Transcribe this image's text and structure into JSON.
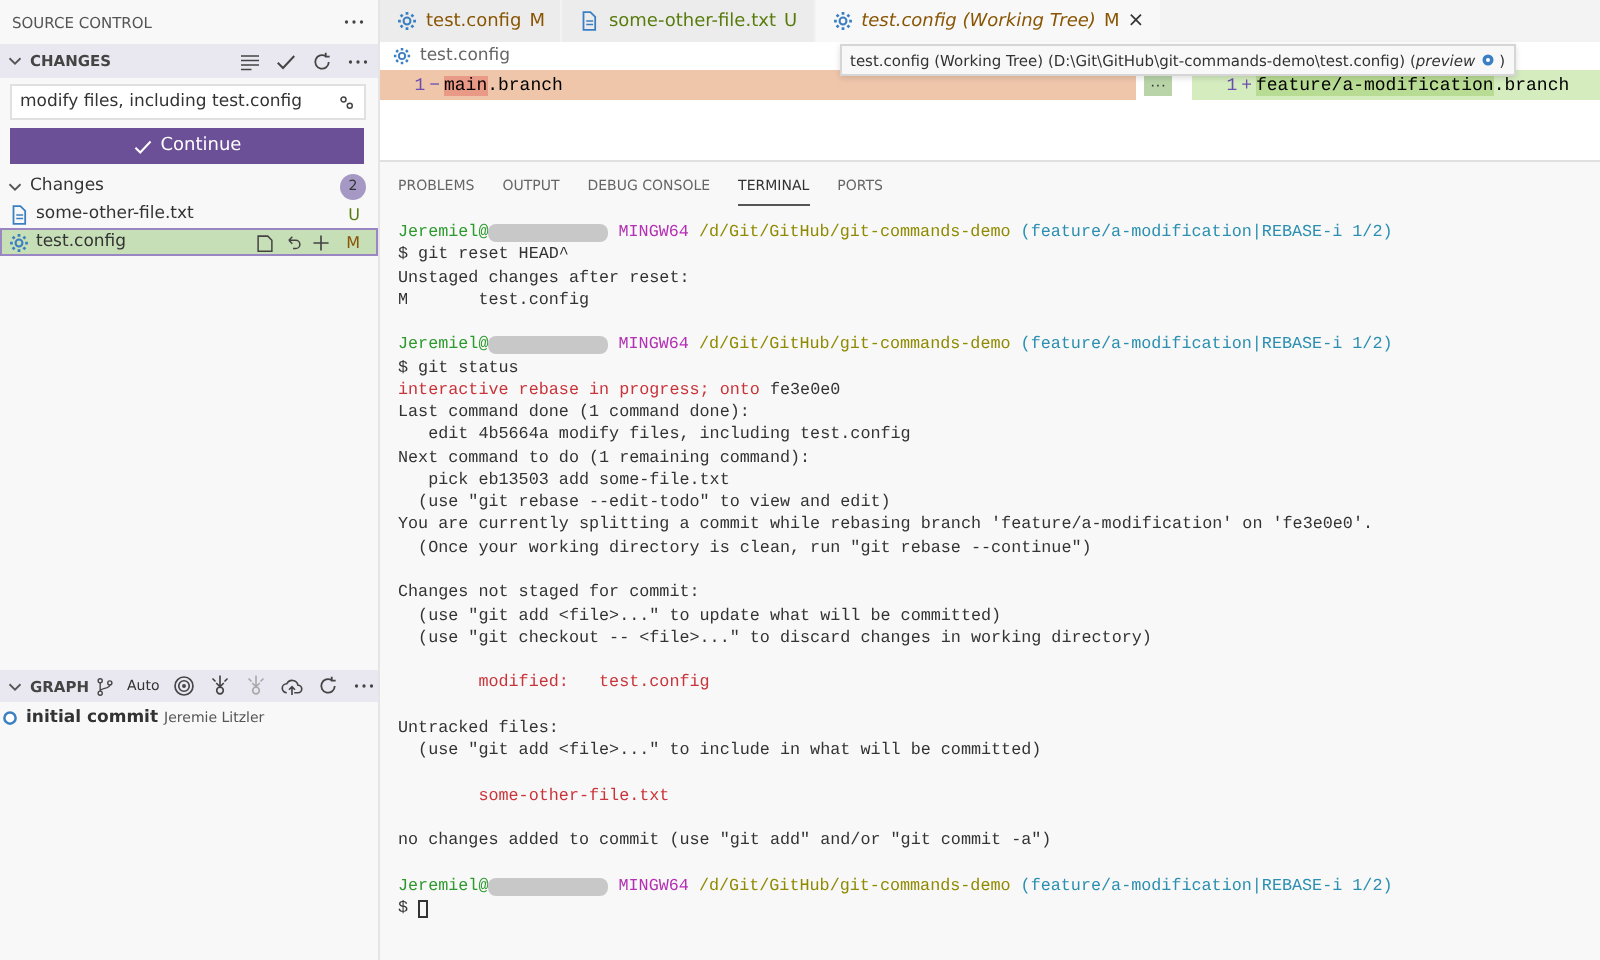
{
  "sidebar": {
    "title": "SOURCE CONTROL",
    "changes_section": {
      "title": "CHANGES",
      "expanded": true
    },
    "commit_message": "modify files, including test.config",
    "continue_button": "Continue",
    "changes_group": {
      "label": "Changes",
      "count": "2",
      "expanded": true
    },
    "files": [
      {
        "name": "some-other-file.txt",
        "kind": "file",
        "status": "U",
        "color": "#587c0c",
        "selected": false
      },
      {
        "name": "test.config",
        "kind": "config",
        "status": "M",
        "color": "#895503",
        "selected": true
      }
    ],
    "graph": {
      "title": "GRAPH",
      "expanded": true,
      "mode": "Auto",
      "commits": [
        {
          "message": "initial commit",
          "author": "Jeremie Litzler"
        }
      ]
    }
  },
  "editor": {
    "tabs": [
      {
        "label": "test.config",
        "kind": "config",
        "status": "M",
        "color": "#895503",
        "preview": false,
        "selected": false
      },
      {
        "label": "some-other-file.txt",
        "kind": "file",
        "status": "U",
        "color": "#587c0c",
        "preview": false,
        "selected": false
      },
      {
        "label": "test.config (Working Tree)",
        "kind": "config",
        "status": "M",
        "color": "#895503",
        "preview": true,
        "selected": true,
        "close": "×"
      }
    ],
    "breadcrumb": "test.config",
    "tooltip": {
      "text": "test.config (Working Tree) (D:\\Git\\GitHub\\git-commands-demo\\test.config) (*preview*",
      "suffix": ")"
    },
    "diff": {
      "left": {
        "line": "1",
        "sign": "−",
        "changed": "main",
        "rest": ".branch"
      },
      "right": {
        "line": "1",
        "sign": "+",
        "changed": "feature/a-modification",
        "rest": ".branch"
      },
      "fold": "···"
    }
  },
  "panel": {
    "tabs": [
      {
        "label": "PROBLEMS",
        "selected": false
      },
      {
        "label": "OUTPUT",
        "selected": false
      },
      {
        "label": "DEBUG CONSOLE",
        "selected": false
      },
      {
        "label": "TERMINAL",
        "selected": true
      },
      {
        "label": "PORTS",
        "selected": false
      }
    ],
    "terminal": [
      {
        "kind": "text",
        "segments": [
          {
            "text": "Jeremiel@",
            "kind": "user"
          },
          {
            "kind": "redacted"
          },
          {
            "text": " MINGW64",
            "kind": "host"
          },
          {
            "text": " /d/Git/GitHub/git-commands-demo",
            "kind": "path"
          },
          {
            "text": " (feature/a-modification|REBASE-i 1/2)",
            "kind": "branch"
          }
        ]
      },
      {
        "kind": "text",
        "segments": [
          {
            "text": "$ git reset HEAD^",
            "kind": "plain"
          }
        ]
      },
      {
        "kind": "text",
        "segments": [
          {
            "text": "Unstaged changes after reset:",
            "kind": "plain"
          }
        ]
      },
      {
        "kind": "text",
        "segments": [
          {
            "text": "M       test.config",
            "kind": "plain"
          }
        ]
      },
      {
        "kind": "blank"
      },
      {
        "kind": "text",
        "segments": [
          {
            "text": "Jeremiel@",
            "kind": "user"
          },
          {
            "kind": "redacted"
          },
          {
            "text": " MINGW64",
            "kind": "host"
          },
          {
            "text": " /d/Git/GitHub/git-commands-demo",
            "kind": "path"
          },
          {
            "text": " (feature/a-modification|REBASE-i 1/2)",
            "kind": "branch"
          }
        ]
      },
      {
        "kind": "text",
        "segments": [
          {
            "text": "$ git status",
            "kind": "plain"
          }
        ]
      },
      {
        "kind": "text",
        "segments": [
          {
            "text": "interactive rebase in progress; onto",
            "kind": "red"
          },
          {
            "text": " fe3e0e0",
            "kind": "plain"
          }
        ]
      },
      {
        "kind": "text",
        "segments": [
          {
            "text": "Last command done (1 command done):",
            "kind": "plain"
          }
        ]
      },
      {
        "kind": "text",
        "segments": [
          {
            "text": "   edit 4b5664a modify files, including test.config",
            "kind": "plain"
          }
        ]
      },
      {
        "kind": "text",
        "segments": [
          {
            "text": "Next command to do (1 remaining command):",
            "kind": "plain"
          }
        ]
      },
      {
        "kind": "text",
        "segments": [
          {
            "text": "   pick eb13503 add some-file.txt",
            "kind": "plain"
          }
        ]
      },
      {
        "kind": "text",
        "segments": [
          {
            "text": "  (use \"git rebase --edit-todo\" to view and edit)",
            "kind": "plain"
          }
        ]
      },
      {
        "kind": "text",
        "segments": [
          {
            "text": "You are currently splitting a commit while rebasing branch 'feature/a-modification' on 'fe3e0e0'.",
            "kind": "plain"
          }
        ]
      },
      {
        "kind": "text",
        "segments": [
          {
            "text": "  (Once your working directory is clean, run \"git rebase --continue\")",
            "kind": "plain"
          }
        ]
      },
      {
        "kind": "blank"
      },
      {
        "kind": "text",
        "segments": [
          {
            "text": "Changes not staged for commit:",
            "kind": "plain"
          }
        ]
      },
      {
        "kind": "text",
        "segments": [
          {
            "text": "  (use \"git add <file>...\" to update what will be committed)",
            "kind": "plain"
          }
        ]
      },
      {
        "kind": "text",
        "segments": [
          {
            "text": "  (use \"git checkout -- <file>...\" to discard changes in working directory)",
            "kind": "plain"
          }
        ]
      },
      {
        "kind": "blank"
      },
      {
        "kind": "text",
        "segments": [
          {
            "text": "        modified:   test.config",
            "kind": "red"
          }
        ]
      },
      {
        "kind": "blank"
      },
      {
        "kind": "text",
        "segments": [
          {
            "text": "Untracked files:",
            "kind": "plain"
          }
        ]
      },
      {
        "kind": "text",
        "segments": [
          {
            "text": "  (use \"git add <file>...\" to include in what will be committed)",
            "kind": "plain"
          }
        ]
      },
      {
        "kind": "blank"
      },
      {
        "kind": "text",
        "segments": [
          {
            "text": "        some-other-file.txt",
            "kind": "red"
          }
        ]
      },
      {
        "kind": "blank"
      },
      {
        "kind": "text",
        "segments": [
          {
            "text": "no changes added to commit (use \"git add\" and/or \"git commit -a\")",
            "kind": "plain"
          }
        ]
      },
      {
        "kind": "blank"
      },
      {
        "kind": "text",
        "segments": [
          {
            "text": "Jeremiel@",
            "kind": "user"
          },
          {
            "kind": "redacted"
          },
          {
            "text": " MINGW64",
            "kind": "host"
          },
          {
            "text": " /d/Git/GitHub/git-commands-demo",
            "kind": "path"
          },
          {
            "text": " (feature/a-modification|REBASE-i 1/2)",
            "kind": "branch"
          }
        ]
      },
      {
        "kind": "text",
        "segments": [
          {
            "text": "$ ",
            "kind": "plain"
          },
          {
            "kind": "cursor"
          }
        ]
      }
    ]
  }
}
